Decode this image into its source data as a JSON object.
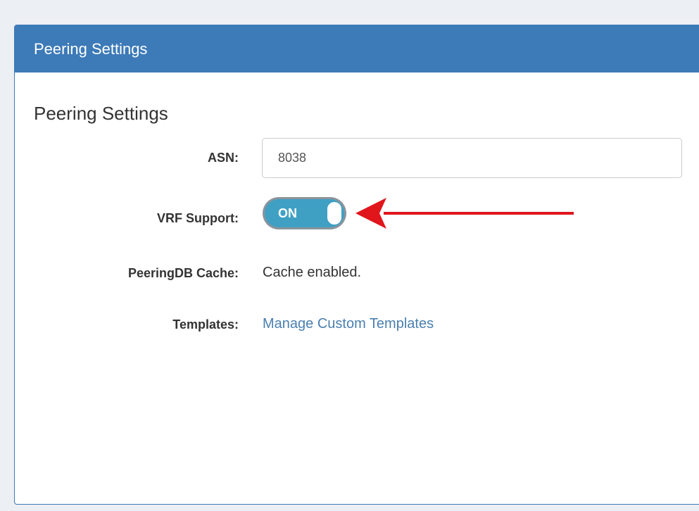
{
  "panel": {
    "header_title": "Peering Settings",
    "section_title": "Peering Settings"
  },
  "fields": {
    "asn_label": "ASN:",
    "asn_value": "8038",
    "vrf_label": "VRF Support:",
    "vrf_toggle_text": "ON",
    "vrf_enabled": true,
    "cache_label": "PeeringDB Cache:",
    "cache_value": "Cache enabled.",
    "templates_label": "Templates:",
    "templates_link": "Manage Custom Templates"
  },
  "annotation": {
    "icon": "red-arrow-icon",
    "color": "#e0161c"
  },
  "colors": {
    "header_bg": "#3d7ab8",
    "toggle_on": "#3fa0c4",
    "link": "#4a7fb0"
  }
}
